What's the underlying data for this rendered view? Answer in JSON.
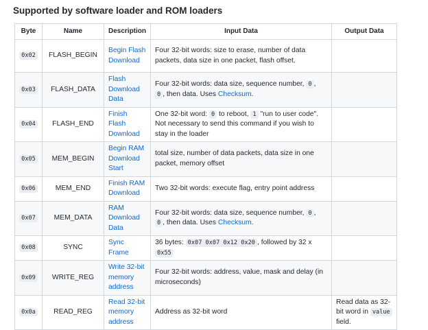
{
  "section_title": "Supported by software loader and ROM loaders",
  "table": {
    "headers": {
      "byte": "Byte",
      "name": "Name",
      "description": "Description",
      "input": "Input Data",
      "output": "Output Data"
    },
    "rows": [
      {
        "byte": "0x02",
        "name": "FLASH_BEGIN",
        "description": "Begin Flash Download",
        "input": [
          {
            "t": "Four 32-bit words: size to erase, number of data packets, data size in one packet, flash offset."
          }
        ],
        "output": []
      },
      {
        "byte": "0x03",
        "name": "FLASH_DATA",
        "description": "Flash Download Data",
        "input": [
          {
            "t": "Four 32-bit words: data size, sequence number, "
          },
          {
            "c": "0"
          },
          {
            "t": ", "
          },
          {
            "c": "0"
          },
          {
            "t": ", then data. Uses "
          },
          {
            "a": "Checksum"
          },
          {
            "t": "."
          }
        ],
        "output": []
      },
      {
        "byte": "0x04",
        "name": "FLASH_END",
        "description": "Finish Flash Download",
        "input": [
          {
            "t": "One 32-bit word: "
          },
          {
            "c": "0"
          },
          {
            "t": " to reboot, "
          },
          {
            "c": "1"
          },
          {
            "t": " \"run to user code\". Not necessary to send this command if you wish to stay in the loader"
          }
        ],
        "output": []
      },
      {
        "byte": "0x05",
        "name": "MEM_BEGIN",
        "description": "Begin RAM Download Start",
        "input": [
          {
            "t": "total size, number of data packets, data size in one packet, memory offset"
          }
        ],
        "output": []
      },
      {
        "byte": "0x06",
        "name": "MEM_END",
        "description": "Finish RAM Download",
        "input": [
          {
            "t": "Two 32-bit words: execute flag, entry point address"
          }
        ],
        "output": []
      },
      {
        "byte": "0x07",
        "name": "MEM_DATA",
        "description": "RAM Download Data",
        "input": [
          {
            "t": "Four 32-bit words: data size, sequence number, "
          },
          {
            "c": "0"
          },
          {
            "t": ", "
          },
          {
            "c": "0"
          },
          {
            "t": ", then data. Uses "
          },
          {
            "a": "Checksum"
          },
          {
            "t": "."
          }
        ],
        "output": []
      },
      {
        "byte": "0x08",
        "name": "SYNC",
        "description": "Sync Frame",
        "input": [
          {
            "t": "36 bytes: "
          },
          {
            "c": "0x07 0x07 0x12 0x20"
          },
          {
            "t": ", followed by 32 x "
          },
          {
            "c": "0x55"
          }
        ],
        "output": []
      },
      {
        "byte": "0x09",
        "name": "WRITE_REG",
        "description": "Write 32-bit memory address",
        "input": [
          {
            "t": "Four 32-bit words: address, value, mask and delay (in microseconds)"
          }
        ],
        "output": []
      },
      {
        "byte": "0x0a",
        "name": "READ_REG",
        "description": "Read 32-bit memory address",
        "input": [
          {
            "t": "Address as 32-bit word"
          }
        ],
        "output": [
          {
            "t": "Read data as 32-bit word in "
          },
          {
            "c": "value"
          },
          {
            "t": " field."
          }
        ]
      }
    ]
  }
}
